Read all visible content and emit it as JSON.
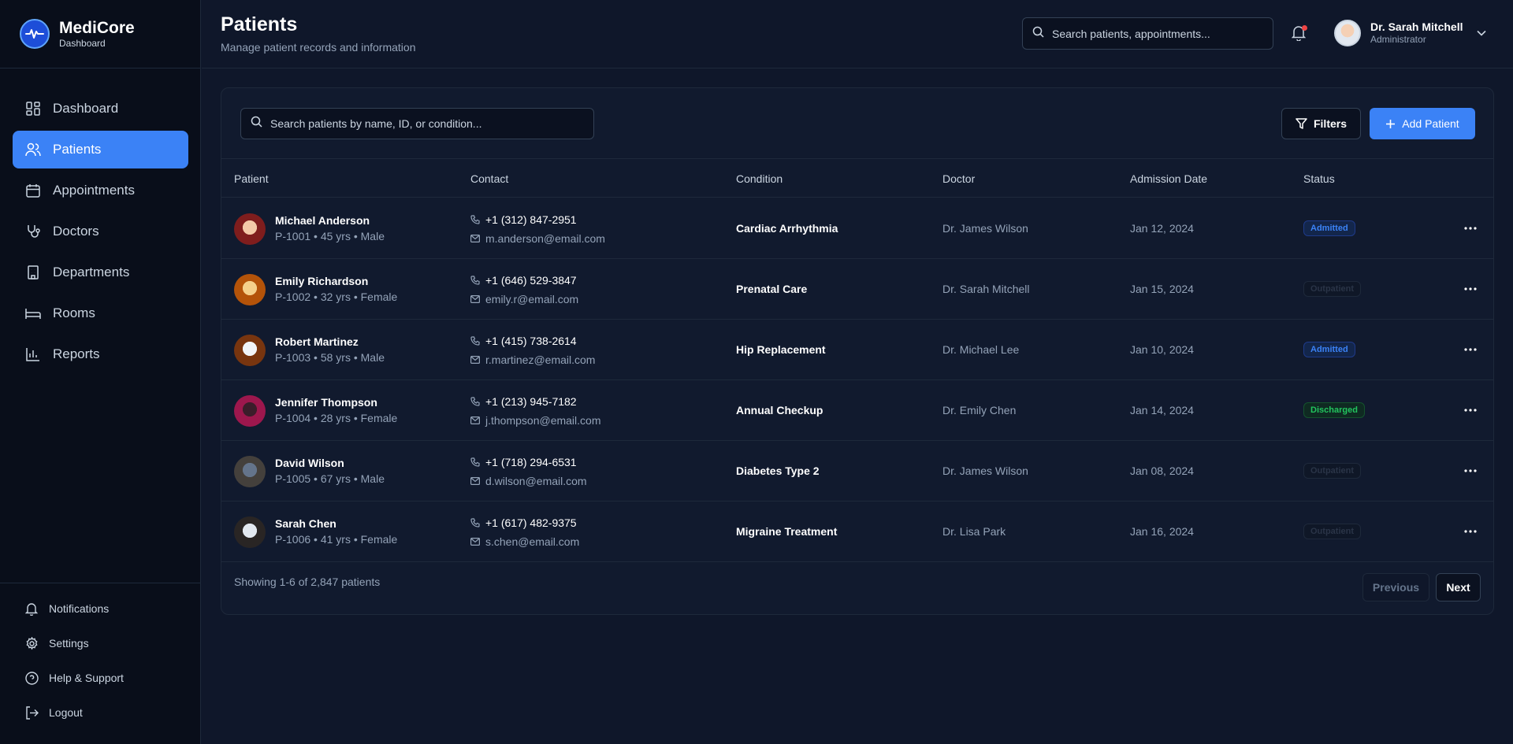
{
  "brand": {
    "name": "MediCore",
    "subtitle": "Dashboard"
  },
  "sidebar": {
    "nav": [
      {
        "label": "Dashboard",
        "icon": "grid-icon",
        "active": false
      },
      {
        "label": "Patients",
        "icon": "users-icon",
        "active": true
      },
      {
        "label": "Appointments",
        "icon": "calendar-icon",
        "active": false
      },
      {
        "label": "Doctors",
        "icon": "stethoscope-icon",
        "active": false
      },
      {
        "label": "Departments",
        "icon": "building-icon",
        "active": false
      },
      {
        "label": "Rooms",
        "icon": "bed-icon",
        "active": false
      },
      {
        "label": "Reports",
        "icon": "bar-chart-icon",
        "active": false
      }
    ],
    "bottom": [
      {
        "label": "Notifications",
        "icon": "bell-icon"
      },
      {
        "label": "Settings",
        "icon": "gear-icon"
      },
      {
        "label": "Help & Support",
        "icon": "help-circle-icon"
      },
      {
        "label": "Logout",
        "icon": "logout-icon"
      }
    ]
  },
  "header": {
    "title": "Patients",
    "subtitle": "Manage patient records and information",
    "search_placeholder": "Search patients, appointments...",
    "user": {
      "name": "Dr. Sarah Mitchell",
      "role": "Administrator"
    }
  },
  "toolbar": {
    "search_placeholder": "Search patients by name, ID, or condition...",
    "filters_label": "Filters",
    "add_label": "Add Patient"
  },
  "table": {
    "columns": [
      "Patient",
      "Contact",
      "Condition",
      "Doctor",
      "Admission Date",
      "Status"
    ],
    "rows": [
      {
        "name": "Michael Anderson",
        "meta": "P-1001 • 45 yrs • Male",
        "phone": "+1 (312) 847-2951",
        "email": "m.anderson@email.com",
        "condition": "Cardiac Arrhythmia",
        "doctor": "Dr. James Wilson",
        "date": "Jan 12, 2024",
        "status": "Admitted"
      },
      {
        "name": "Emily Richardson",
        "meta": "P-1002 • 32 yrs • Female",
        "phone": "+1 (646) 529-3847",
        "email": "emily.r@email.com",
        "condition": "Prenatal Care",
        "doctor": "Dr. Sarah Mitchell",
        "date": "Jan 15, 2024",
        "status": "Outpatient"
      },
      {
        "name": "Robert Martinez",
        "meta": "P-1003 • 58 yrs • Male",
        "phone": "+1 (415) 738-2614",
        "email": "r.martinez@email.com",
        "condition": "Hip Replacement",
        "doctor": "Dr. Michael Lee",
        "date": "Jan 10, 2024",
        "status": "Admitted"
      },
      {
        "name": "Jennifer Thompson",
        "meta": "P-1004 • 28 yrs • Female",
        "phone": "+1 (213) 945-7182",
        "email": "j.thompson@email.com",
        "condition": "Annual Checkup",
        "doctor": "Dr. Emily Chen",
        "date": "Jan 14, 2024",
        "status": "Discharged"
      },
      {
        "name": "David Wilson",
        "meta": "P-1005 • 67 yrs • Male",
        "phone": "+1 (718) 294-6531",
        "email": "d.wilson@email.com",
        "condition": "Diabetes Type 2",
        "doctor": "Dr. James Wilson",
        "date": "Jan 08, 2024",
        "status": "Outpatient"
      },
      {
        "name": "Sarah Chen",
        "meta": "P-1006 • 41 yrs • Female",
        "phone": "+1 (617) 482-9375",
        "email": "s.chen@email.com",
        "condition": "Migraine Treatment",
        "doctor": "Dr. Lisa Park",
        "date": "Jan 16, 2024",
        "status": "Outpatient"
      }
    ]
  },
  "pagination": {
    "summary": "Showing 1-6 of 2,847 patients",
    "prev_label": "Previous",
    "next_label": "Next"
  },
  "colors": {
    "background": "#0f172a",
    "accent": "#3b82f6",
    "admitted": "#3b82f6",
    "discharged": "#22c55e",
    "alert": "#ef4444"
  }
}
